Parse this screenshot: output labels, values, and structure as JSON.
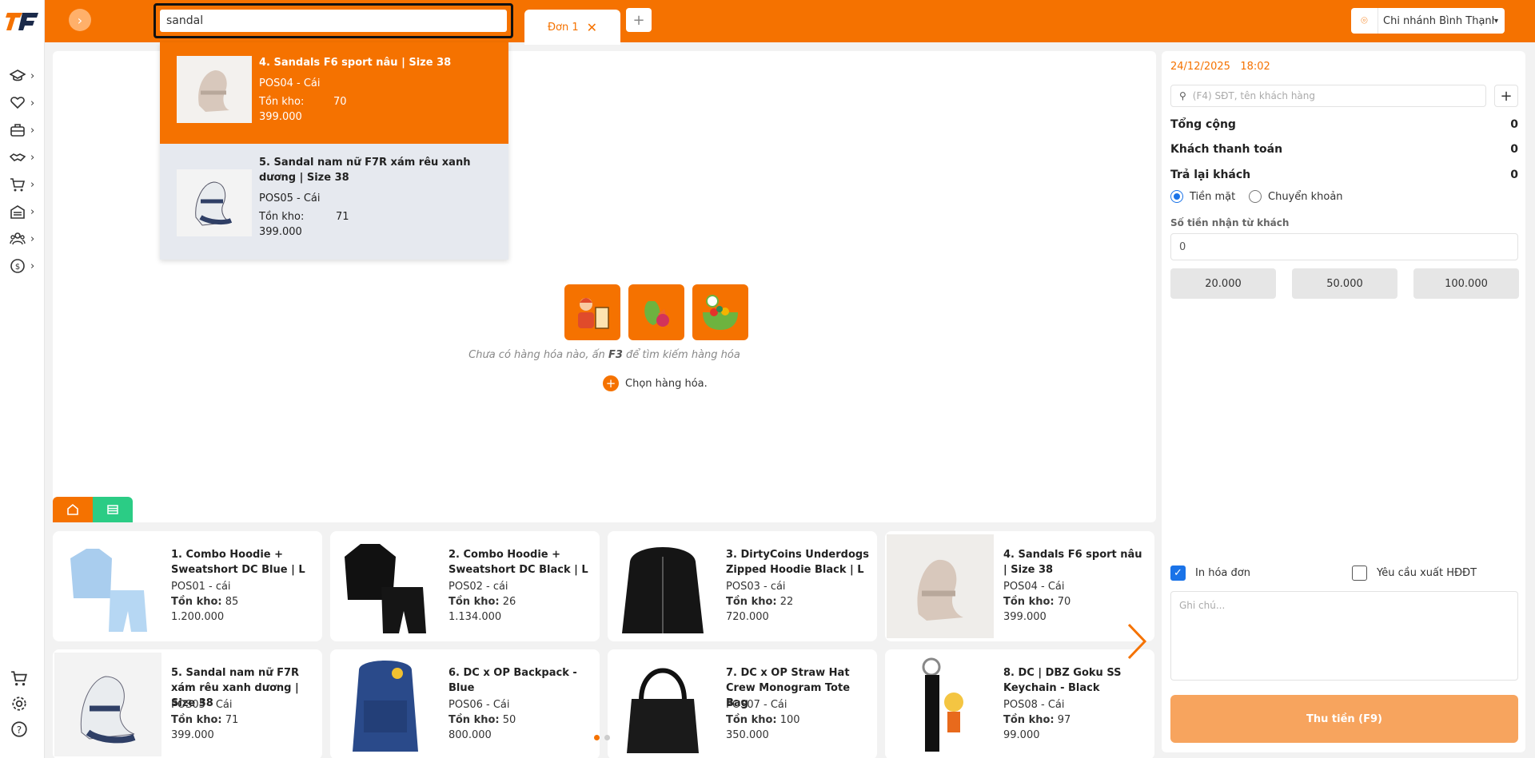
{
  "search": {
    "value": "sandal"
  },
  "tabs": {
    "order_label": "Đơn 1",
    "add_label": "+"
  },
  "branch": {
    "name": "Chi nhánh Bình Thạnh"
  },
  "dropdown": [
    {
      "title": "4. Sandals F6 sport nâu | Size 38",
      "code": "POS04 - Cái",
      "stock_label": "Tồn kho:",
      "stock": "70",
      "price": "399.000"
    },
    {
      "title": "5. Sandal nam nữ F7R xám rêu xanh dương | Size 38",
      "code": "POS05 - Cái",
      "stock_label": "Tồn kho:",
      "stock": "71",
      "price": "399.000"
    }
  ],
  "empty": {
    "text_before": "Chưa có hàng hóa nào, ấn ",
    "key": "F3",
    "text_after": " để tìm kiếm hàng hóa",
    "choose": "Chọn hàng hóa."
  },
  "products": [
    {
      "title": "1. Combo Hoodie + Sweatshort DC Blue | L",
      "code": "POS01 - cái",
      "stock_label": "Tồn kho:",
      "stock": "85",
      "price": "1.200.000",
      "img": "hoodie-blue"
    },
    {
      "title": "2. Combo Hoodie + Sweatshort DC Black | L",
      "code": "POS02 - cái",
      "stock_label": "Tồn kho:",
      "stock": "26",
      "price": "1.134.000",
      "img": "hoodie-black"
    },
    {
      "title": "3. DirtyCoins Underdogs Zipped Hoodie Black | L",
      "code": "POS03 - cái",
      "stock_label": "Tồn kho:",
      "stock": "22",
      "price": "720.000",
      "img": "zip-hoodie"
    },
    {
      "title": "4. Sandals F6 sport nâu | Size 38",
      "code": "POS04 - Cái",
      "stock_label": "Tồn kho:",
      "stock": "70",
      "price": "399.000",
      "img": "sandal-beige"
    },
    {
      "title": "5. Sandal nam nữ F7R xám rêu xanh dương | Size 38",
      "code": "POS05 - Cái",
      "stock_label": "Tồn kho:",
      "stock": "71",
      "price": "399.000",
      "img": "sandal-navy"
    },
    {
      "title": "6. DC x OP Backpack - Blue",
      "code": "POS06 - Cái",
      "stock_label": "Tồn kho:",
      "stock": "50",
      "price": "800.000",
      "img": "backpack"
    },
    {
      "title": "7. DC x OP Straw Hat Crew Monogram Tote Bag",
      "code": "POS07 - Cái",
      "stock_label": "Tồn kho:",
      "stock": "100",
      "price": "350.000",
      "img": "tote"
    },
    {
      "title": "8. DC | DBZ Goku SS Keychain - Black",
      "code": "POS08 - Cái",
      "stock_label": "Tồn kho:",
      "stock": "97",
      "price": "99.000",
      "img": "keychain"
    }
  ],
  "checkout": {
    "date": "24/12/2025",
    "time": "18:02",
    "customer_placeholder": "(F4) SĐT, tên khách hàng",
    "total_label": "Tổng cộng",
    "total_value": "0",
    "paid_label": "Khách thanh toán",
    "paid_value": "0",
    "change_label": "Trả lại khách",
    "change_value": "0",
    "cash_label": "Tiền mặt",
    "transfer_label": "Chuyển khoản",
    "received_label": "Số tiền nhận từ khách",
    "received_value": "0",
    "quick_amounts": [
      "20.000",
      "50.000",
      "100.000"
    ],
    "print_label": "In hóa đơn",
    "einvoice_label": "Yêu cầu xuất HĐĐT",
    "note_placeholder": "Ghi chú...",
    "pay_label": "Thu tiền (F9)"
  },
  "colors": {
    "accent": "#f57200",
    "green": "#2bcc85",
    "blue": "#1a73e8"
  },
  "sidebar_icons": [
    "graduation-cap-icon",
    "handshake-heart-icon",
    "briefcase-icon",
    "handshake-icon",
    "cart-icon",
    "warehouse-icon",
    "users-icon",
    "coin-icon"
  ]
}
